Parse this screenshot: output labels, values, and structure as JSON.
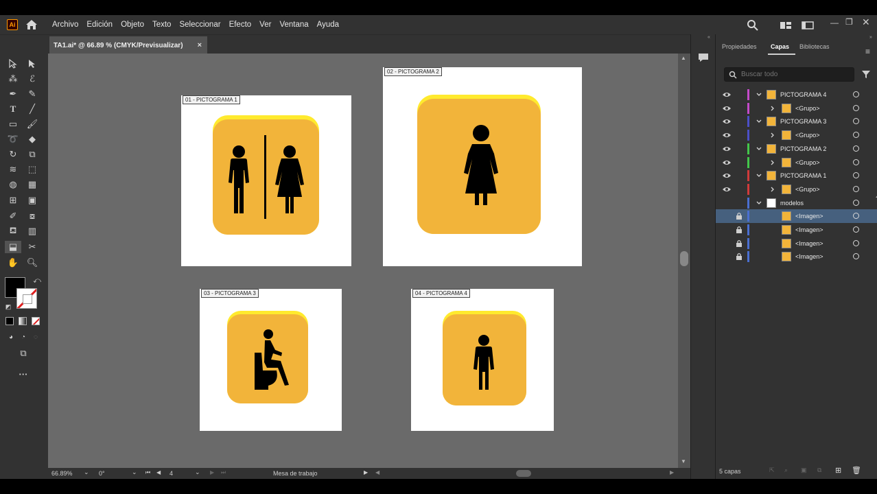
{
  "app": {
    "logo_text": "Ai"
  },
  "menu": {
    "items": [
      "Archivo",
      "Edición",
      "Objeto",
      "Texto",
      "Seleccionar",
      "Efecto",
      "Ver",
      "Ventana",
      "Ayuda"
    ]
  },
  "document": {
    "tab_title": "TA1.ai* @ 66.89 % (CMYK/Previsualizar)",
    "close_glyph": "×"
  },
  "artboards": [
    {
      "label": "01 - PICTOGRAMA 1",
      "icon": "man-woman-restroom-icon"
    },
    {
      "label": "02 - PICTOGRAMA 2",
      "icon": "woman-restroom-icon"
    },
    {
      "label": "03 - PICTOGRAMA 3",
      "icon": "toilet-person-icon"
    },
    {
      "label": "04 - PICTOGRAMA 4",
      "icon": "man-restroom-icon"
    }
  ],
  "colors": {
    "picto_fill": "#f2b43a",
    "picto_highlight": "#ffea2e",
    "selected_row": "#46607e"
  },
  "status": {
    "zoom": "66.89%",
    "rotation": "0°",
    "artboard_number": "4",
    "tool_name": "Mesa de trabajo"
  },
  "panel": {
    "tabs": [
      "Propiedades",
      "Capas",
      "Bibliotecas"
    ],
    "active_tab": "Capas",
    "search_placeholder": "Buscar todo",
    "layers": [
      {
        "name": "PICTOGRAMA 4",
        "color": "#c44ac9",
        "level": 0,
        "visible": true
      },
      {
        "name": "<Grupo>",
        "color": "#c44ac9",
        "level": 1,
        "visible": true
      },
      {
        "name": "PICTOGRAMA 3",
        "color": "#4b4fc7",
        "level": 0,
        "visible": true
      },
      {
        "name": "<Grupo>",
        "color": "#4b4fc7",
        "level": 1,
        "visible": true
      },
      {
        "name": "PICTOGRAMA 2",
        "color": "#43c64a",
        "level": 0,
        "visible": true
      },
      {
        "name": "<Grupo>",
        "color": "#43c64a",
        "level": 1,
        "visible": true
      },
      {
        "name": "PICTOGRAMA 1",
        "color": "#d03a3a",
        "level": 0,
        "visible": true
      },
      {
        "name": "<Grupo>",
        "color": "#d03a3a",
        "level": 1,
        "visible": true
      },
      {
        "name": "modelos",
        "color": "#4a6fd1",
        "level": 0,
        "visible": false
      },
      {
        "name": "<Imagen>",
        "color": "#4a6fd1",
        "level": 1,
        "locked": true,
        "selected": true
      },
      {
        "name": "<Imagen>",
        "color": "#4a6fd1",
        "level": 1,
        "locked": true
      },
      {
        "name": "<Imagen>",
        "color": "#4a6fd1",
        "level": 1,
        "locked": true
      },
      {
        "name": "<Imagen>",
        "color": "#4a6fd1",
        "level": 1,
        "locked": true
      }
    ],
    "footer_count": "5 capas"
  }
}
